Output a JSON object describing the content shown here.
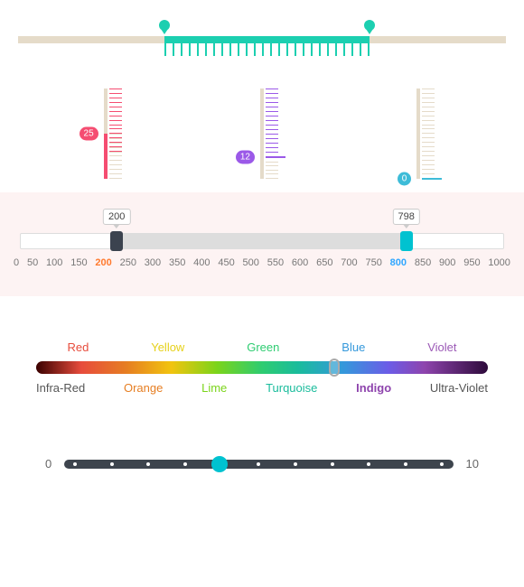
{
  "rangeSlider": {
    "min": 0,
    "max": 100,
    "low": 30,
    "high": 72
  },
  "vertical": {
    "pink": {
      "min": 0,
      "max": 50,
      "value": 25,
      "label": "25"
    },
    "purple": {
      "min": 0,
      "max": 50,
      "value": 12,
      "label": "12"
    },
    "blue": {
      "min": 0,
      "max": 50,
      "value": 0,
      "label": "0"
    }
  },
  "numericRange": {
    "min": 0,
    "max": 1000,
    "low": 200,
    "high": 798,
    "lowLabel": "200",
    "highLabel": "798",
    "ticks": [
      "0",
      "50",
      "100",
      "150",
      "200",
      "250",
      "300",
      "350",
      "400",
      "450",
      "500",
      "550",
      "600",
      "650",
      "700",
      "750",
      "800",
      "850",
      "900",
      "950",
      "1000"
    ],
    "activeLeftNearest": "200",
    "activeRightNearest": "800"
  },
  "spectrum": {
    "top": [
      "Red",
      "Yellow",
      "Green",
      "Blue",
      "Violet"
    ],
    "bottom": [
      "Infra-Red",
      "Orange",
      "Lime",
      "Turquoise",
      "Indigo",
      "Ultra-Violet"
    ],
    "valuePercent": 66,
    "selected": "Indigo"
  },
  "pip": {
    "min": "0",
    "max": "10",
    "value": 4,
    "count": 10
  }
}
